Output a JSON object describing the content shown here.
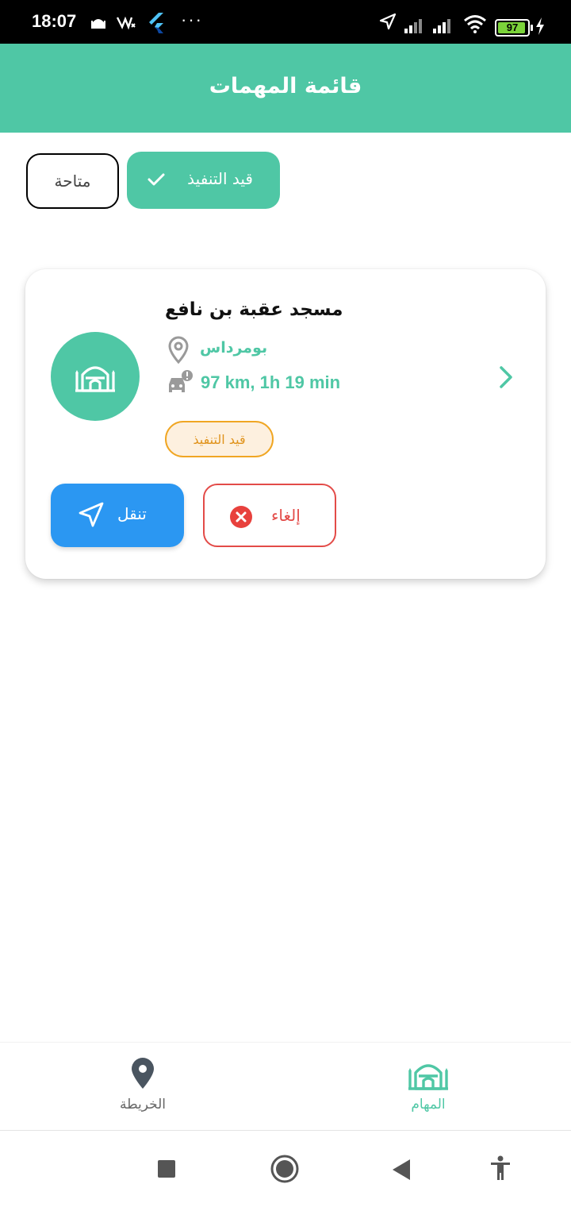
{
  "status_bar": {
    "time": "18:07",
    "battery": "97",
    "icons": [
      "mosque-notification-icon",
      "data-usage-icon",
      "flutter-icon",
      "more-dots-icon",
      "location-arrow-icon",
      "signal-icon",
      "signal-icon",
      "wifi-icon",
      "battery-icon",
      "charging-icon"
    ]
  },
  "app_bar": {
    "title": "قائمة المهمات"
  },
  "filters": {
    "available": "متاحة",
    "in_progress": "قيد التنفيذ"
  },
  "task_card": {
    "name": "مسجد عقبة بن نافع",
    "location": "بومرداس",
    "distance_time": "97 km, 1h 19 min",
    "status": "قيد التنفيذ",
    "navigate_label": "تنقل",
    "cancel_label": "إلغاء"
  },
  "bottom_nav": {
    "map_label": "الخريطة",
    "tasks_label": "المهام"
  },
  "colors": {
    "primary": "#4fc7a5",
    "navigate": "#2b97f2",
    "cancel": "#e34b48",
    "badge_border": "#f0a623"
  }
}
